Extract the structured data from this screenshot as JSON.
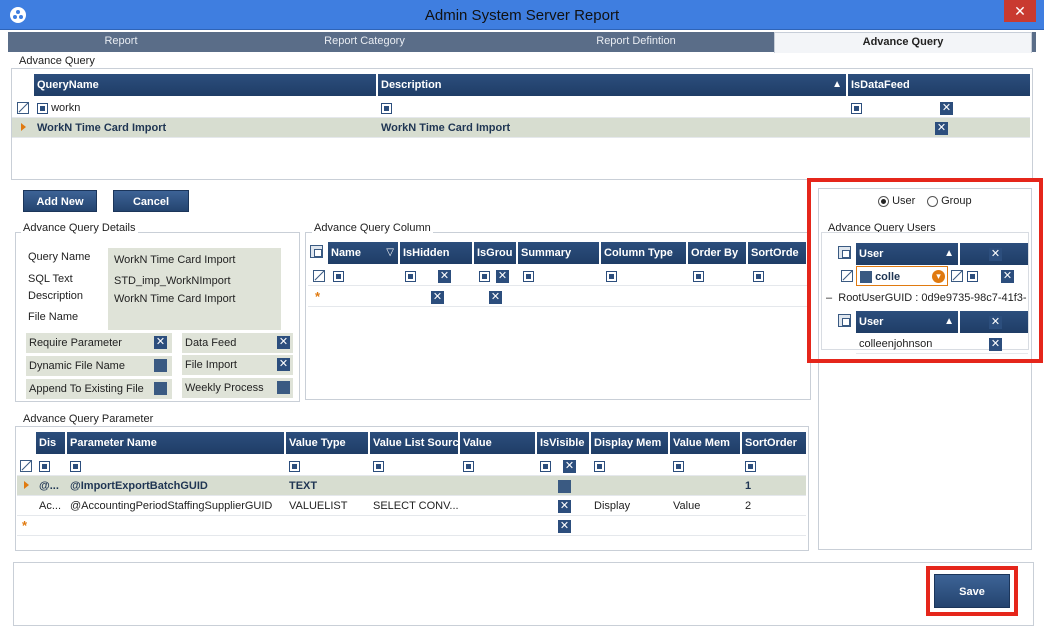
{
  "window": {
    "title": "Admin System Server Report",
    "close": "✕"
  },
  "tabs": [
    {
      "label": "Report"
    },
    {
      "label": "Report Category"
    },
    {
      "label": "Report Defintion"
    },
    {
      "label": "Advance Query"
    }
  ],
  "query_grid": {
    "title": "Advance Query",
    "columns": [
      "QueryName",
      "Description",
      "IsDataFeed"
    ],
    "filter_value": "workn",
    "rows": [
      {
        "name": "WorkN Time Card Import",
        "description": "WorkN Time Card Import"
      }
    ]
  },
  "buttons": {
    "add_new": "Add New",
    "cancel": "Cancel",
    "save": "Save"
  },
  "details": {
    "title": "Advance Query Details",
    "query_name_label": "Query  Name",
    "query_name_value": "WorkN Time Card Import",
    "sql_text_label": "SQL Text",
    "sql_text_value": "STD_imp_WorkNImport",
    "description_label": "Description",
    "description_value": "WorkN Time Card Import",
    "file_name_label": "File Name",
    "require_parameter": "Require Parameter",
    "dynamic_file_name": "Dynamic File Name",
    "append_to_existing_file": "Append To Existing File",
    "data_feed": "Data Feed",
    "file_import": "File Import",
    "weekly_process": "Weekly Process"
  },
  "column_grid": {
    "title": "Advance Query Column",
    "columns": [
      "Name",
      "IsHidden",
      "IsGrou",
      "Summary",
      "Column Type",
      "Order By",
      "SortOrde"
    ]
  },
  "users_panel": {
    "radio_user": "User",
    "radio_group": "Group",
    "title": "Advance Query Users",
    "column_user": "User",
    "filter_value": "colle",
    "root_label": "RootUserGUID : 0d9e9735-98c7-41f3-",
    "child_column_user": "User",
    "child_user": "colleenjohnson"
  },
  "param_grid": {
    "title": "Advance Query Parameter",
    "columns": [
      "Dis",
      "Parameter Name",
      "Value Type",
      "Value List Sourc",
      "Value",
      "IsVisible",
      "Display Mem",
      "Value Mem",
      "SortOrder"
    ],
    "rows": [
      {
        "dis": "@...",
        "name": "@ImportExportBatchGUID",
        "type": "TEXT",
        "source": "",
        "value": "",
        "display": "",
        "valuemem": "",
        "sort": "1"
      },
      {
        "dis": "Ac...",
        "name": "@AccountingPeriodStaffingSupplierGUID",
        "type": "VALUELIST",
        "source": "SELECT  CONV...",
        "value": "",
        "display": "Display",
        "valuemem": "Value",
        "sort": "2"
      }
    ]
  },
  "colors": {
    "header": "#2c4e7d",
    "highlight": "#e5261b",
    "tabstrip": "#5a6d88"
  }
}
